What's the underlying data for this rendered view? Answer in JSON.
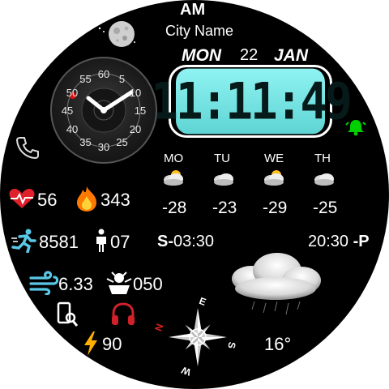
{
  "top": {
    "ampm": "AM",
    "city": "City Name"
  },
  "date": {
    "weekday": "MON",
    "day": "22",
    "month": "JAN"
  },
  "clock": {
    "time": "11:11:49"
  },
  "dial": {
    "numbers": [
      "60",
      "5",
      "10",
      "15",
      "20",
      "25",
      "30",
      "35",
      "40",
      "45",
      "50",
      "55"
    ]
  },
  "forecast": [
    {
      "day": "MO",
      "temp": "-28",
      "icon": "partly-cloudy-icon"
    },
    {
      "day": "TU",
      "temp": "-23",
      "icon": "cloudy-icon"
    },
    {
      "day": "WE",
      "temp": "-29",
      "icon": "partly-cloudy-icon"
    },
    {
      "day": "TH",
      "temp": "-25",
      "icon": "cloudy-icon"
    }
  ],
  "stats": {
    "heart_rate": "56",
    "calories": "343",
    "steps": "8581",
    "floors": "07",
    "distance": "6.33",
    "stress": "050",
    "battery": "90",
    "temperature": "16°"
  },
  "sun": {
    "sunrise_prefix": "S-",
    "sunrise": "03:30",
    "sunset": "20:30",
    "sunset_suffix": "-P"
  },
  "compass": {
    "n": "N",
    "e": "E",
    "s": "S",
    "w": "W"
  },
  "colors": {
    "lcd": "#7fe7e6",
    "alarm": "#00d000",
    "heart": "#e0202a",
    "flame": "#ff7a00",
    "run": "#59c8e6",
    "bolt": "#ffb000",
    "headphones": "#d0202a"
  }
}
